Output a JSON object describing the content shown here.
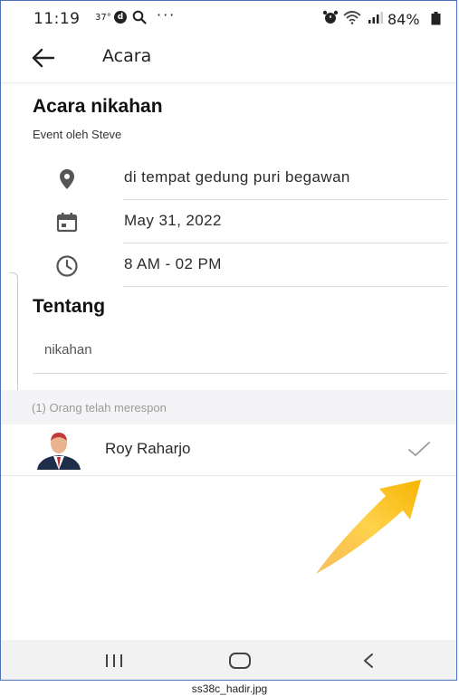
{
  "status_bar": {
    "time": "11:19",
    "temp": "37°",
    "d_badge": "d",
    "more": "···",
    "battery": "84%",
    "icons": [
      "search-icon",
      "alarm-icon",
      "wifi-icon",
      "signal-icon",
      "battery-icon"
    ]
  },
  "app_bar": {
    "back_icon": "arrow-left-icon",
    "title": "Acara"
  },
  "event": {
    "title": "Acara nikahan",
    "subtitle": "Event oleh Steve",
    "details": [
      {
        "icon": "location-pin-icon",
        "text": "di tempat gedung puri begawan"
      },
      {
        "icon": "calendar-icon",
        "text": "May 31, 2022"
      },
      {
        "icon": "clock-icon",
        "text": "8 AM - 02 PM"
      }
    ]
  },
  "about": {
    "heading": "Tentang",
    "text": "nikahan"
  },
  "responses": {
    "header": "(1) Orang telah merespon",
    "attendees": [
      {
        "name": "Roy Raharjo",
        "status_icon": "checkmark-icon",
        "avatar_icon": "user-avatar-icon"
      }
    ]
  },
  "nav_bar": {
    "icons": [
      "recent-apps-icon",
      "home-icon",
      "back-icon"
    ]
  },
  "caption": "ss38c_hadir.jpg",
  "colors": {
    "accent_arrow": "#f5b400",
    "icon_gray": "#555555",
    "frame_border": "#4a72b8"
  }
}
